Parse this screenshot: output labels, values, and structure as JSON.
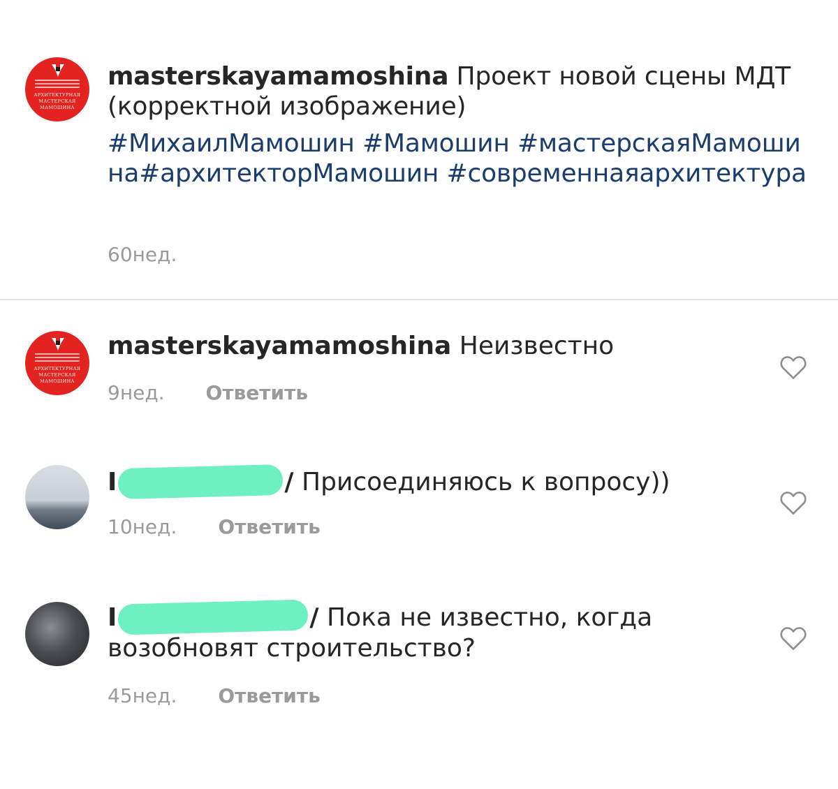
{
  "caption": {
    "avatar_logo_text": [
      "АРХИТЕКТУРНАЯ",
      "МАСТЕРСКАЯ",
      "МАМОШИНА"
    ],
    "username": "masterskayamamoshina",
    "text": "Проект новой сцены МДТ (корректной изображение)",
    "hashtags": "#МихаилМамошин #Мамошин #мастерскаяМамошина#архитекторМамошин #современнаяархитектура",
    "time": "60нед."
  },
  "comments": [
    {
      "username": "masterskayamamoshina",
      "text": "Неизвестно",
      "time": "9нед.",
      "reply_label": "Ответить"
    },
    {
      "username_visible_start": "I",
      "username_visible_end": "/",
      "text": "Присоединяюсь к вопросу))",
      "time": "10нед.",
      "reply_label": "Ответить"
    },
    {
      "username_visible_start": "I",
      "username_visible_end": "/",
      "text": "Пока не известно, когда возобновят строительство?",
      "time": "45нед.",
      "reply_label": "Ответить"
    }
  ],
  "colors": {
    "brand_red": "#e3231f",
    "hashtag_blue": "#1b3d6e",
    "redaction_green": "#6ff0c3",
    "meta_gray": "#9a9a9a"
  },
  "icons": [
    "heart-icon"
  ]
}
